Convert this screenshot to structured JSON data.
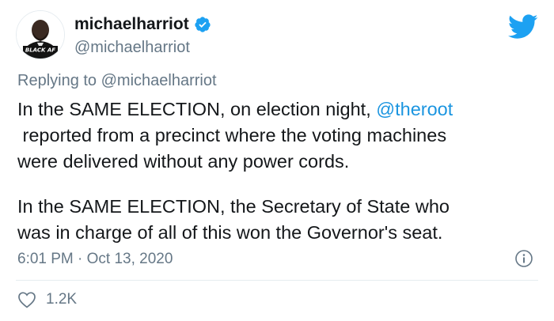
{
  "author": {
    "display_name": "michaelharriot",
    "handle": "@michaelharriot",
    "avatar_caption": "BLACK AF",
    "verified": true
  },
  "reply": {
    "prefix": "Replying to",
    "target": "@michaelharriot"
  },
  "body": {
    "line1_pre": "In the SAME ELECTION, on election night,",
    "line1_mention": "@theroot",
    "line2": "reported from a precinct where the voting machines",
    "line3": "were delivered without any power cords.",
    "line4": "In the SAME ELECTION, the Secretary of State who",
    "line5": "was in charge of all of this won the Governor's seat."
  },
  "meta": {
    "timestamp": "6:01 PM · Oct 13, 2020"
  },
  "engagement": {
    "likes": "1.2K"
  },
  "icons": {
    "verified": "verified-badge-icon",
    "brand": "twitter-bird-icon",
    "info": "info-icon",
    "like": "heart-icon"
  },
  "colors": {
    "accent": "#1da1f2",
    "mention": "#1b95e0",
    "secondary_text": "#657786",
    "primary_text": "#14171a"
  }
}
